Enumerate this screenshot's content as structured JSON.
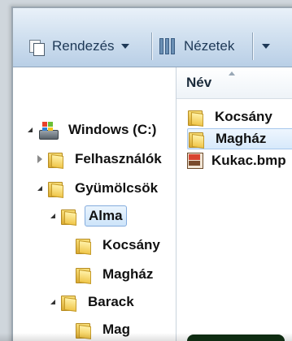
{
  "toolbar": {
    "organize_label": "Rendezés",
    "views_label": "Nézetek"
  },
  "tree": {
    "drive": "Windows (C:)",
    "items": [
      {
        "label": "Felhasználók",
        "expander": "collapsed"
      },
      {
        "label": "Gyümölcsök",
        "expander": "expanded"
      },
      {
        "label": "Alma",
        "expander": "expanded",
        "selected": true
      },
      {
        "label": "Kocsány",
        "expander": "none"
      },
      {
        "label": "Magház",
        "expander": "none"
      },
      {
        "label": "Barack",
        "expander": "expanded"
      },
      {
        "label": "Mag",
        "expander": "none"
      }
    ]
  },
  "file_list": {
    "column_name": "Név",
    "files": [
      {
        "name": "Kocsány",
        "type": "folder"
      },
      {
        "name": "Magház",
        "type": "folder",
        "selected": true
      },
      {
        "name": "Kukac.bmp",
        "type": "bmp"
      }
    ]
  },
  "colors": {
    "toolbar_top": "#e9f1f9",
    "toolbar_bottom": "#b9cfe6",
    "selection_border": "#84acdd",
    "folder_yellow": "#f0c64a"
  }
}
